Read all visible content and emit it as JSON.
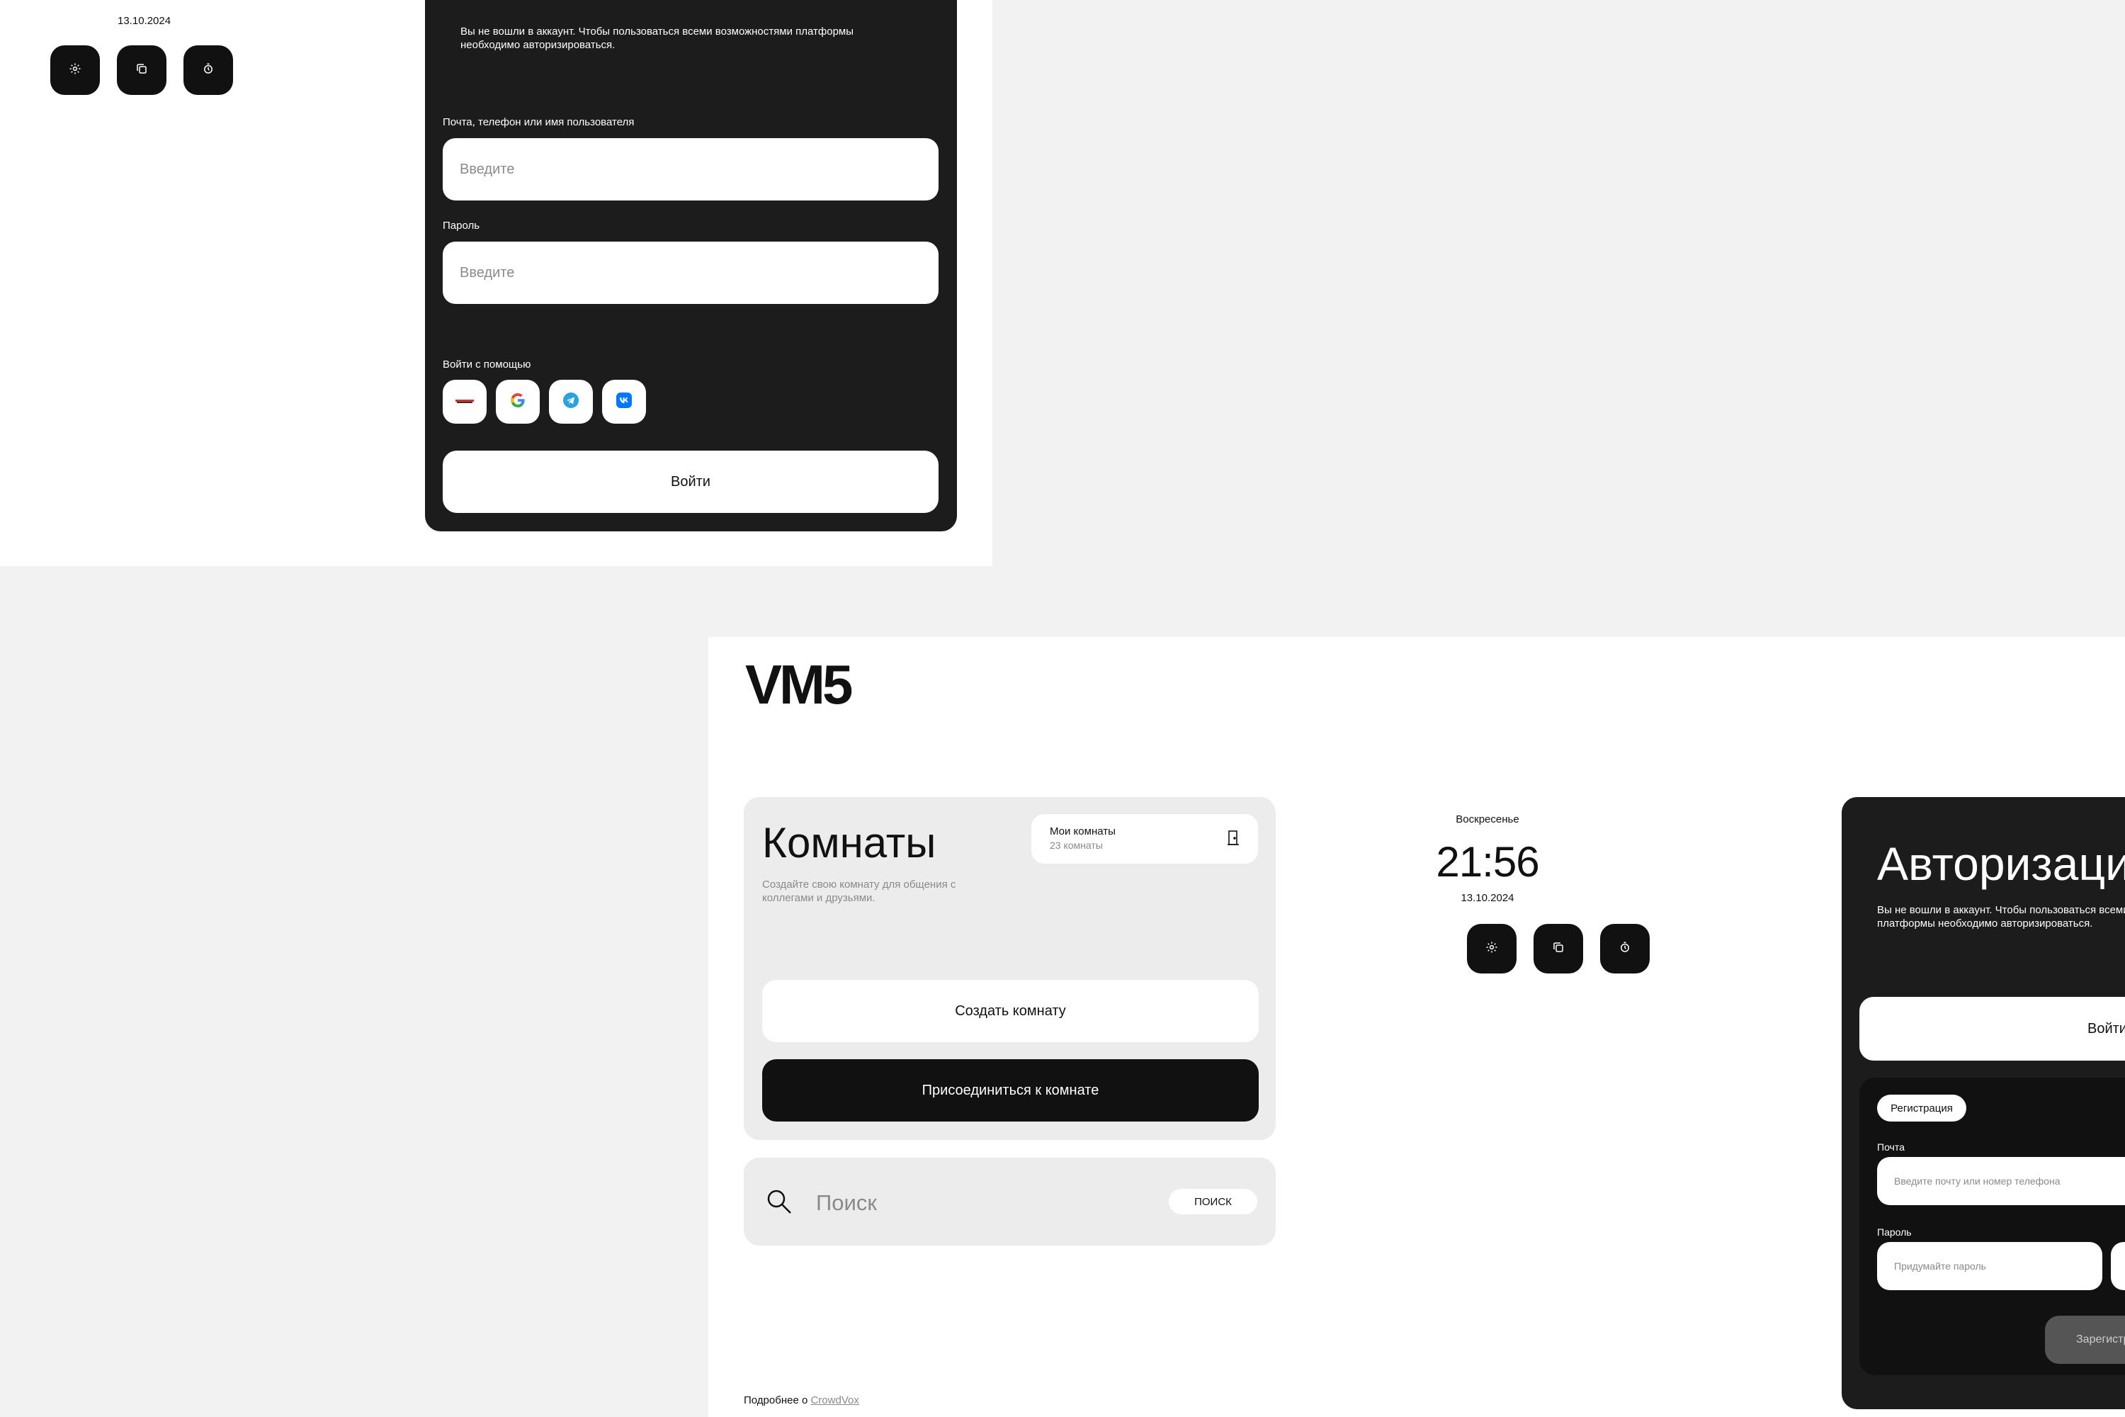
{
  "top_frame": {
    "date": "13.10.2024",
    "icon_buttons": [
      "gear-icon",
      "copy-icon",
      "clock-icon"
    ],
    "auth": {
      "description": "Вы не вошли в аккаунт. Чтобы пользоваться всеми возможностями платформы необходимо авторизироваться.",
      "login_label": "Почта, телефон или имя пользователя",
      "login_placeholder": "Введите",
      "password_label": "Пароль",
      "password_placeholder": "Введите",
      "social_label": "Войти с помощью",
      "social_providers": [
        "yandex-icon",
        "google-icon",
        "telegram-icon",
        "vk-icon"
      ],
      "submit": "Войти"
    }
  },
  "bottom_frame": {
    "logo": "VM5",
    "rooms": {
      "title": "Комнаты",
      "description": "Создайте свою комнату для общения с коллегами и друзьями.",
      "my_rooms_title": "Мои комнаты",
      "my_rooms_count": "23 комнаты",
      "create_button": "Создать комнату",
      "join_button": "Присоединиться к комнате"
    },
    "search": {
      "placeholder": "Поиск",
      "button": "ПОИСК"
    },
    "clock": {
      "day": "Воскресенье",
      "time": "21:56",
      "date": "13.10.2024"
    },
    "icon_buttons": [
      "gear-icon",
      "copy-icon",
      "clock-icon"
    ],
    "footer": {
      "text": "Подробнее о ",
      "link": "CrowdVox"
    },
    "auth": {
      "title": "Авторизация",
      "description": "Вы не вошли в аккаунт. Чтобы пользоваться всеми возможностями платформы необходимо авторизироваться.",
      "login_button": "Войти",
      "register_tab": "Регистрация",
      "email_label": "Почта",
      "email_placeholder": "Введите почту или номер телефона",
      "password_label": "Пароль",
      "password_placeholder": "Придумайте пароль",
      "submit": "Зарегистрироваться"
    }
  },
  "colors": {
    "background": "#f2f2f2",
    "panel_dark": "#1c1c1c",
    "card_light": "#ececec",
    "muted_text": "#8a8a8a",
    "accent_black": "#111111"
  }
}
